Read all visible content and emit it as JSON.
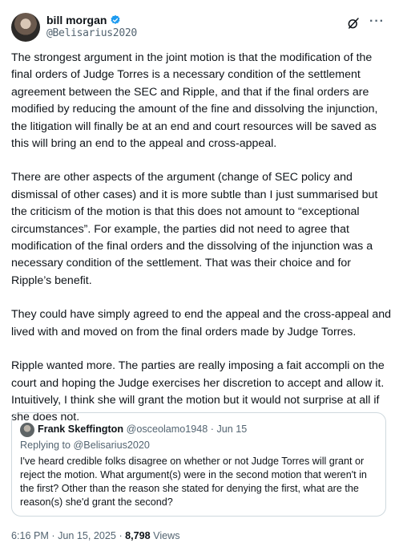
{
  "author": {
    "name": "bill morgan",
    "handle": "@Belisarius2020"
  },
  "paragraphs": [
    "The strongest argument in the joint motion is that the modification of the final orders of Judge Torres is a necessary condition of the settlement agreement between the SEC and Ripple, and that if the final orders are modified by reducing the amount of the fine and dissolving the injunction, the litigation will finally be at an end and court resources will be saved as this will bring an end to the appeal and cross-appeal.",
    "There are other aspects of the argument (change of SEC policy and dismissal of other cases) and it is more subtle than I just summarised but the criticism of the motion is that this does not amount to “exceptional circumstances”. For example, the parties did not need to agree that modification of the final orders and the dissolving of the injunction was a necessary condition of the settlement. That was their choice and for Ripple’s benefit.",
    "They could have simply agreed to end the appeal and the cross-appeal and lived with and moved on from the final orders made by Judge Torres.",
    "Ripple wanted more. The parties are really imposing a fait accompli on the court and hoping the Judge exercises her discretion to accept and allow it. Intuitively, I think she will grant the motion but it would not surprise at all if she does not."
  ],
  "quote": {
    "name": "Frank Skeffington",
    "handle": "@osceolamo1948",
    "separator": "·",
    "date": "Jun 15",
    "reply_prefix": "Replying to",
    "reply_to": "@Belisarius2020",
    "text": "I've heard credible folks disagree on whether or not Judge Torres will grant or reject the motion.  What argument(s) were in the second motion that weren't in the first?  Other than the reason she stated for denying the first, what are the reason(s) she'd grant the second?"
  },
  "footer": {
    "time": "6:16 PM",
    "separator": "·",
    "date": "Jun 15, 2025",
    "views_count": "8,798",
    "views_label": "Views"
  },
  "icons": {
    "verified": "verified-badge-icon",
    "grok": "grok-icon",
    "more": "more-icon"
  },
  "colors": {
    "verified": "#1d9bf0",
    "text": "#0f1419",
    "secondary": "#536471",
    "border": "#cfd9de"
  }
}
